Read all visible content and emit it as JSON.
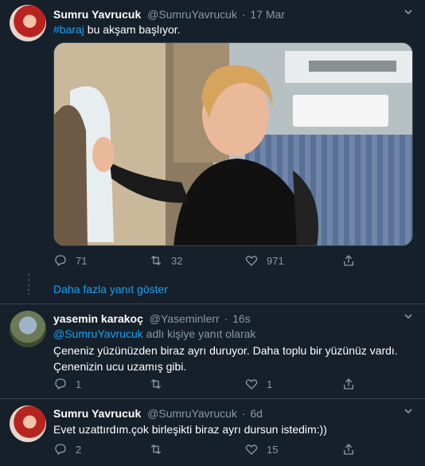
{
  "tweet1": {
    "name": "Sumru Yavrucuk",
    "handle": "@SumruYavrucuk",
    "sep": "·",
    "date": "17 Mar",
    "hashtag": "#baraj",
    "text": " bu akşam başlıyor.",
    "replies": "71",
    "retweets": "32",
    "likes": "971"
  },
  "show_more": "Daha fazla yanıt göster",
  "tweet2": {
    "name": "yasemin karakoç",
    "handle": "@Yaseminlerr",
    "sep": "·",
    "date": "16s",
    "reply_to_handle": "@SumruYavrucuk",
    "reply_to_text": " adlı kişiye yanıt olarak",
    "text_line1": "Çeneniz yüzünüzden biraz ayrı duruyor. Daha toplu bir yüzünüz vardı.",
    "text_line2": "Çenenizin ucu uzamış gibi.",
    "replies": "1",
    "retweets": "",
    "likes": "1"
  },
  "tweet3": {
    "name": "Sumru Yavrucuk",
    "handle": "@SumruYavrucuk",
    "sep": "·",
    "date": "6d",
    "text": "Evet uzattırdım.çok birleşikti biraz ayrı dursun istedim:))",
    "replies": "2",
    "retweets": "",
    "likes": "15"
  },
  "colors": {
    "background": "#15202b",
    "accent": "#1da1f2",
    "muted": "#8899a6",
    "border": "#38444d"
  }
}
